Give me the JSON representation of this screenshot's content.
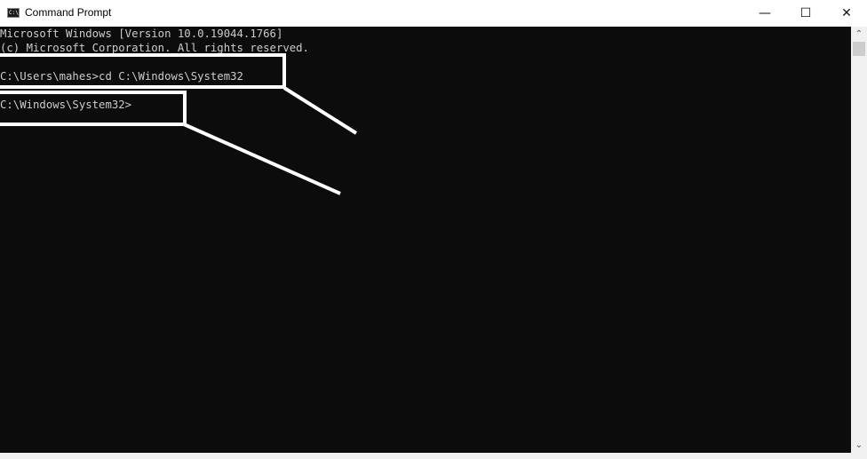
{
  "window": {
    "title": "Command Prompt",
    "icon": "cmd-icon",
    "icon_text": "C:\\.",
    "controls": {
      "minimize": "—",
      "maximize": "☐",
      "close": "✕"
    }
  },
  "console": {
    "lines": [
      "Microsoft Windows [Version 10.0.19044.1766]",
      "(c) Microsoft Corporation. All rights reserved.",
      "",
      "C:\\Users\\mahes>cd C:\\Windows\\System32",
      "",
      "C:\\Windows\\System32>"
    ],
    "background": "#0c0c0c",
    "text_color": "#cccccc"
  },
  "scrollbar": {
    "up": "⌃",
    "down": "⌄"
  },
  "annotations": {
    "highlight_color": "#ffffff",
    "callouts": [
      "cd-command-callout",
      "prompt-callout"
    ]
  }
}
